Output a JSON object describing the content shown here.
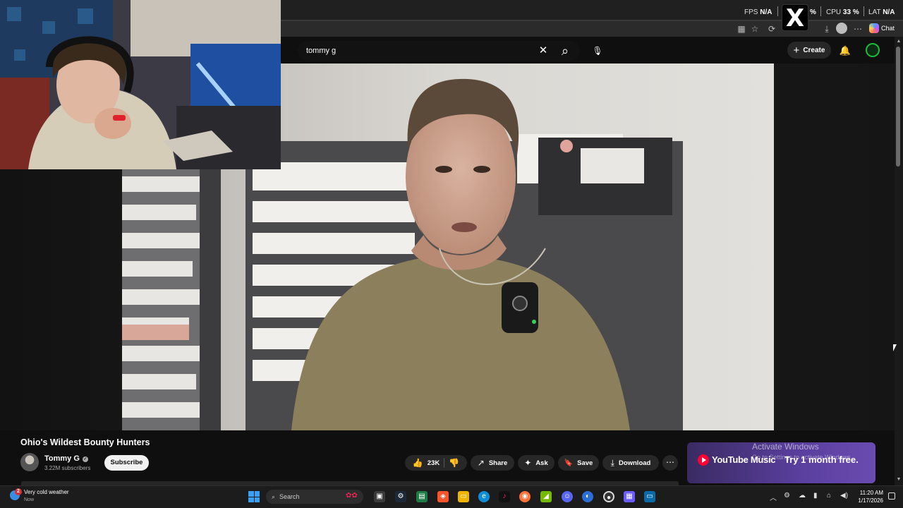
{
  "overlay": {
    "fps_label": "FPS",
    "fps_value": "N/A",
    "cpu_label": "CPU",
    "cpu_value": "33",
    "percent_mark": "%",
    "lat_label": "LAT",
    "lat_value": "N/A",
    "x_logo_glyph": "X"
  },
  "browser": {
    "copilot_label": "Chat"
  },
  "masthead": {
    "search_value": "tommy g",
    "create_label": "Create"
  },
  "video": {
    "title": "Ohio's Wildest Bounty Hunters",
    "channel_name": "Tommy G",
    "subscribers": "3.22M subscribers",
    "subscribe_label": "Subscribe",
    "like_count": "23K",
    "share_label": "Share",
    "ask_label": "Ask",
    "save_label": "Save",
    "download_label": "Download"
  },
  "promo": {
    "brand": "YouTube Music",
    "offer": "Try 1 month free."
  },
  "watermark": {
    "line1": "Activate Windows",
    "line2": "Go to Settings to activate Windows."
  },
  "taskbar": {
    "weather_text": "Very cold weather",
    "weather_sub": "Now",
    "weather_badge": "2",
    "search_placeholder": "Search",
    "time": "11:20 AM",
    "date": "1/17/2026"
  },
  "icons": {
    "clear": "✕",
    "search": "⌕",
    "mic": "🎙",
    "plus": "+",
    "bell": "🔔",
    "like": "👍",
    "dislike": "👎",
    "share": "↗",
    "ask": "✦",
    "save": "🔖",
    "download": "⤓",
    "more": "⋯"
  }
}
